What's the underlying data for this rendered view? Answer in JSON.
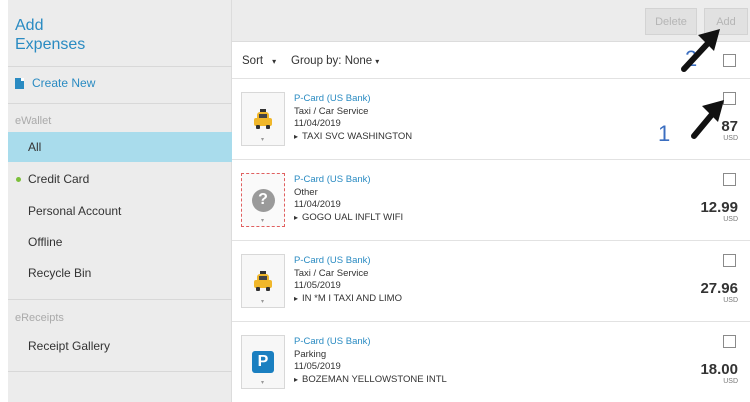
{
  "sidebar": {
    "title_line1": "Add",
    "title_line2": "Expenses",
    "create_new": "Create New",
    "ewallet_label": "eWallet",
    "items": [
      {
        "label": "All"
      },
      {
        "label": "Credit Card"
      },
      {
        "label": "Personal Account"
      },
      {
        "label": "Offline"
      },
      {
        "label": "Recycle Bin"
      }
    ],
    "ereceipts_label": "eReceipts",
    "receipt_gallery": "Receipt Gallery"
  },
  "topbar": {
    "delete_label": "Delete",
    "add_label": "Add"
  },
  "toolbar": {
    "sort_label": "Sort",
    "sort_caret": "▾",
    "group_label": "Group by: None",
    "group_caret": "▾"
  },
  "expenses": [
    {
      "card": "P-Card (US Bank)",
      "type": "Taxi / Car Service",
      "date": "11/04/2019",
      "merchant": "TAXI SVC WASHINGTON",
      "amount": "87",
      "currency": "USD",
      "icon": "taxi-icon"
    },
    {
      "card": "P-Card (US Bank)",
      "type": "Other",
      "date": "11/04/2019",
      "merchant": "GOGO UAL INFLT WIFI",
      "amount": "12.99",
      "currency": "USD",
      "icon": "question-icon"
    },
    {
      "card": "P-Card (US Bank)",
      "type": "Taxi / Car Service",
      "date": "11/05/2019",
      "merchant": "IN *M I TAXI AND LIMO",
      "amount": "27.96",
      "currency": "USD",
      "icon": "taxi-icon"
    },
    {
      "card": "P-Card (US Bank)",
      "type": "Parking",
      "date": "11/05/2019",
      "merchant": "BOZEMAN YELLOWSTONE INTL",
      "amount": "18.00",
      "currency": "USD",
      "icon": "parking-icon"
    }
  ],
  "icons": {
    "parking_letter": "P",
    "question_mark": "?",
    "thumb_caret": "▾"
  },
  "annotations": {
    "label_1": "1",
    "label_2": "2"
  },
  "colors": {
    "accent": "#2a8bc2",
    "selected_bg": "#a9dcec",
    "status_dot": "#7bbf3a",
    "taxi_yellow": "#f0b72a",
    "parking_blue": "#1a7fc0",
    "annotation_blue": "#3b6ec0"
  }
}
